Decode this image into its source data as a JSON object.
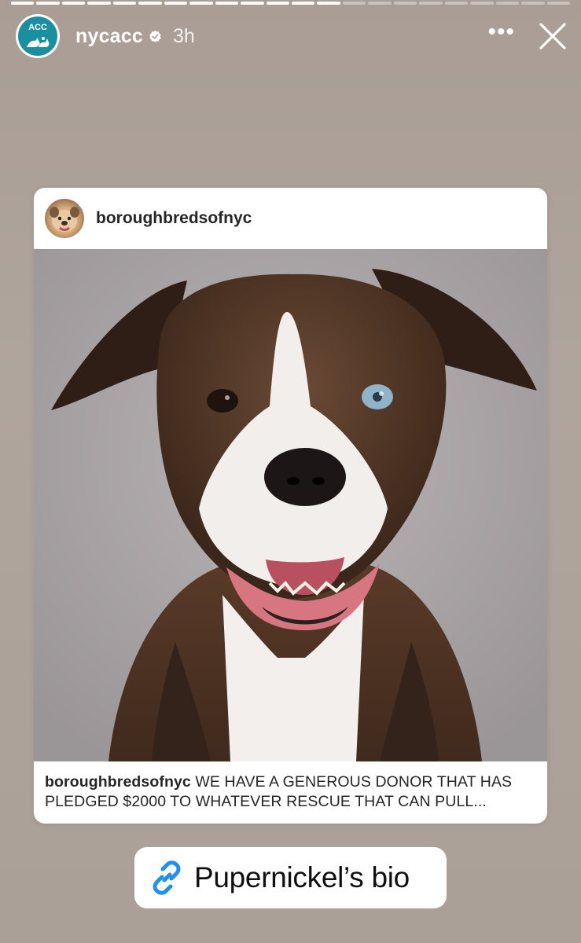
{
  "story": {
    "progress_segments_total": 22,
    "progress_segments_done": 13,
    "account": {
      "username": "nycacc",
      "verified": true,
      "time_ago": "3h",
      "avatar_text": "ACC",
      "avatar_color": "#1a8fa0"
    },
    "icons": {
      "more": "more-options-icon",
      "close": "close-icon",
      "link": "link-icon"
    }
  },
  "shared_post": {
    "author": "boroughbredsofnyc",
    "caption_author": "boroughbredsofnyc",
    "caption_text": " WE HAVE A GENEROUS DONOR THAT HAS PLEDGED $2000 TO WHATEVER RESCUE THAT CAN PULL..."
  },
  "link_sticker": {
    "label": "Pupernickel’s bio",
    "accent": "#1f8ff0"
  }
}
